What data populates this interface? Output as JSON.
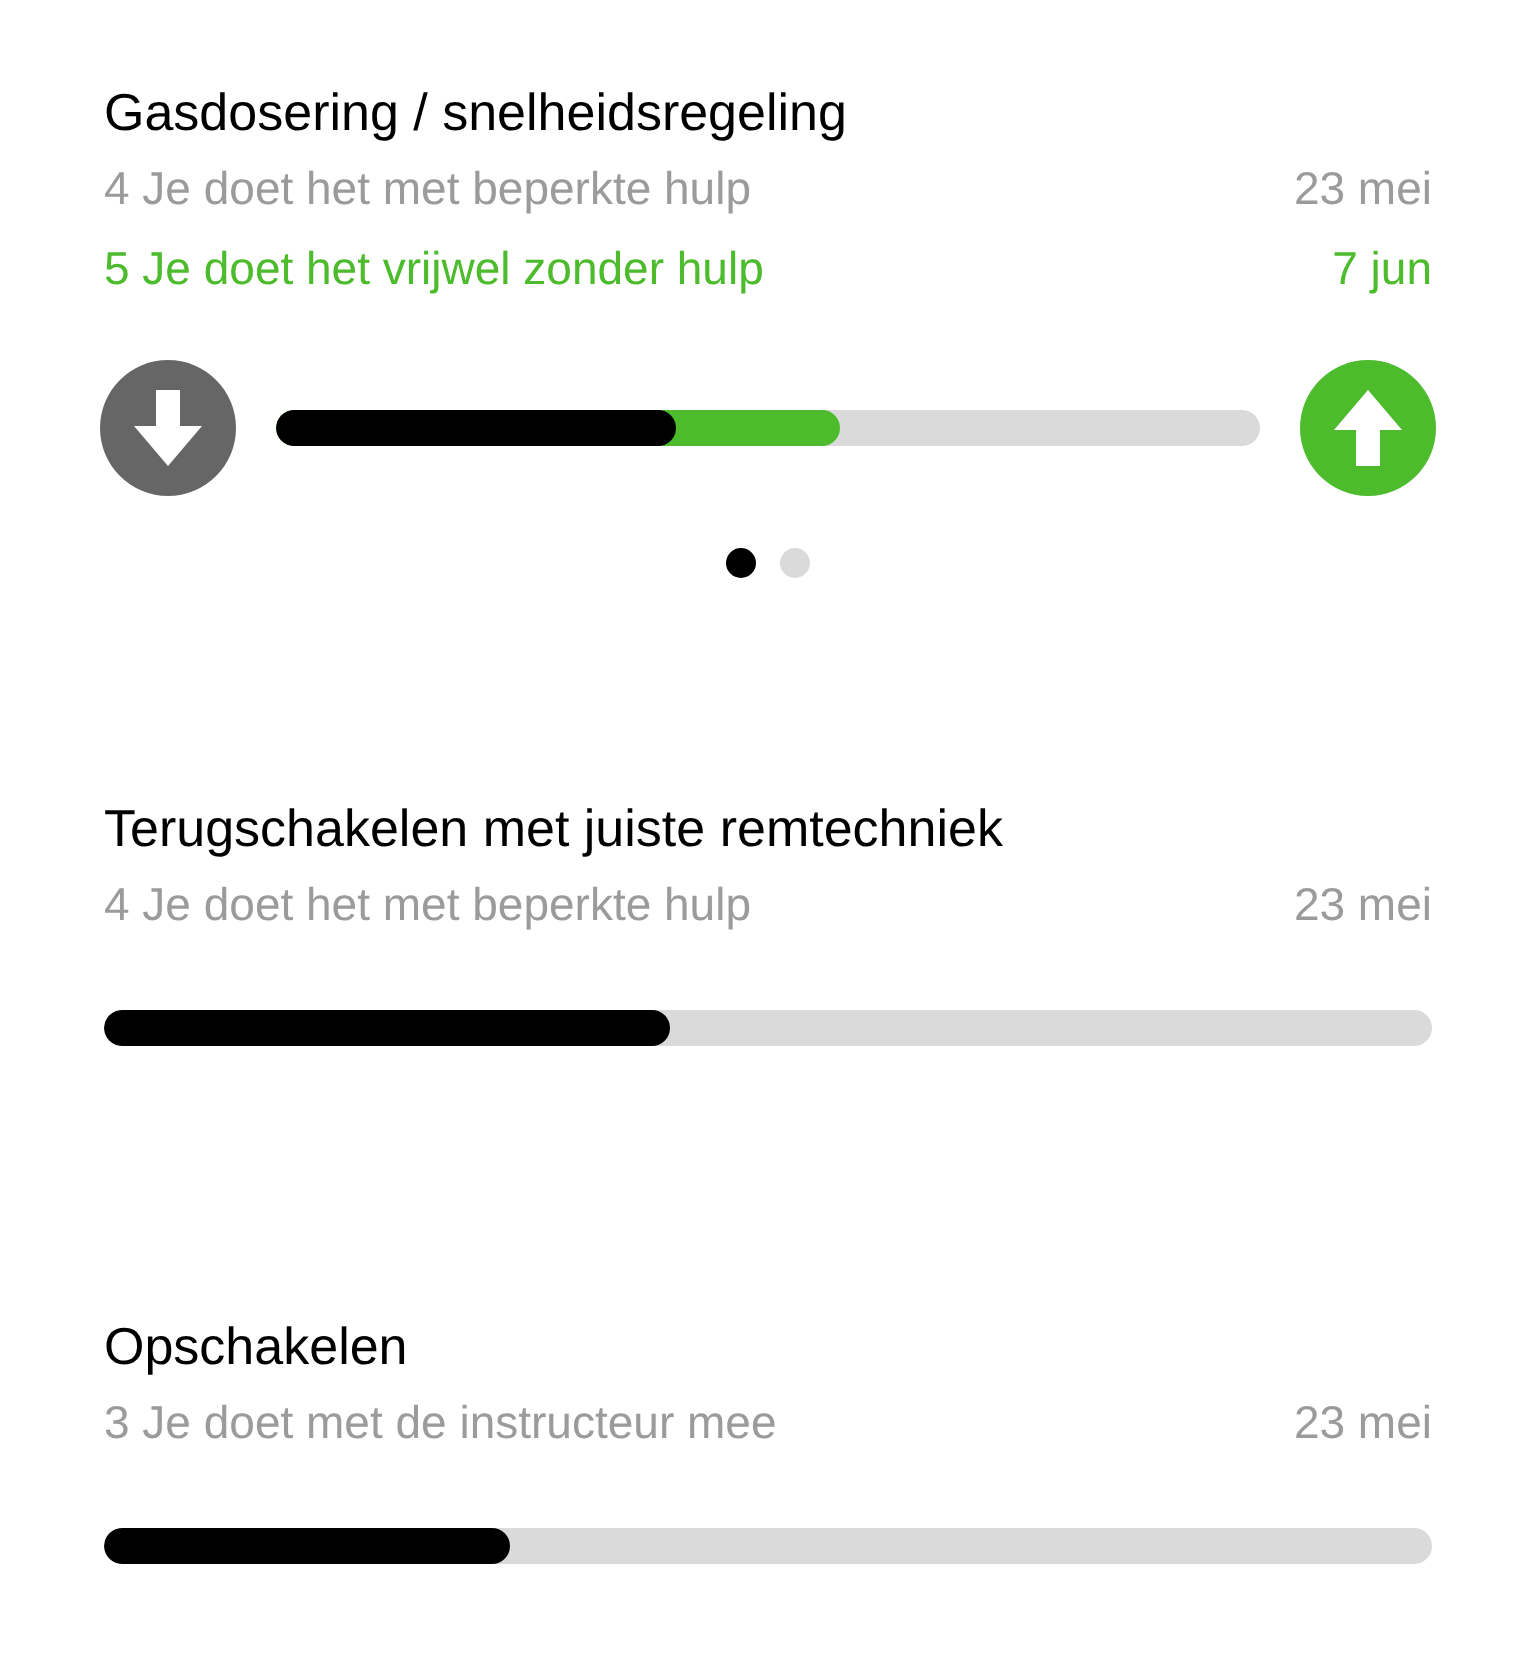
{
  "skills": [
    {
      "title": "Gasdosering / snelheidsregeling",
      "entries": [
        {
          "kind": "current",
          "text": "4 Je doet het met beperkte hulp",
          "date": "23 mei"
        },
        {
          "kind": "target",
          "text": "5 Je doet het vrijwel zonder hulp",
          "date": "7 jun"
        }
      ],
      "bar": [
        {
          "kind": "target",
          "level": 0.574
        },
        {
          "kind": "current",
          "level": 0.406
        }
      ],
      "controls": true,
      "pages": [
        {
          "selected": true
        },
        {
          "selected": false
        }
      ]
    },
    {
      "title": "Terugschakelen met juiste remtechniek",
      "entries": [
        {
          "kind": "current",
          "text": "4 Je doet het met beperkte hulp",
          "date": "23 mei"
        }
      ],
      "bar": [
        {
          "kind": "current",
          "level": 0.426
        }
      ],
      "controls": false
    },
    {
      "title": "Opschakelen",
      "entries": [
        {
          "kind": "current",
          "text": "3 Je doet met de instructeur mee",
          "date": "23 mei"
        }
      ],
      "bar": [
        {
          "kind": "current",
          "level": 0.306
        }
      ],
      "controls": false
    }
  ]
}
